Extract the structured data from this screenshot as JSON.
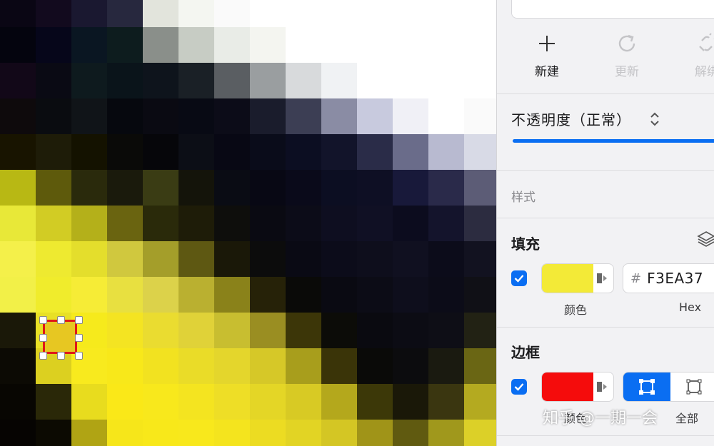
{
  "canvas": {
    "pixel_colors": [
      [
        "#0a0614",
        "#120a1e",
        "#1a1830",
        "#27283e",
        "#e2e4dc",
        "#f4f6f1",
        "#fafafa",
        "#ffffff",
        "#ffffff",
        "#ffffff",
        "#ffffff",
        "#ffffff",
        "#ffffff",
        "#ffffff"
      ],
      [
        "#04040e",
        "#06061a",
        "#0a1622",
        "#0d1c1e",
        "#8a8f8a",
        "#c7ccc4",
        "#e9ece7",
        "#f4f5f0",
        "#ffffff",
        "#ffffff",
        "#ffffff",
        "#ffffff",
        "#ffffff",
        "#ffffff"
      ],
      [
        "#120818",
        "#0a0a14",
        "#0e1a1e",
        "#0a141a",
        "#0e141c",
        "#1a2026",
        "#5a5e62",
        "#9a9ea0",
        "#d8dadc",
        "#f0f2f4",
        "#ffffff",
        "#ffffff",
        "#ffffff",
        "#ffffff"
      ],
      [
        "#0e0a0c",
        "#0a0c10",
        "#101418",
        "#06080e",
        "#0a0a12",
        "#080a14",
        "#0c0c18",
        "#1a1c2c",
        "#3c3e54",
        "#8a8ca4",
        "#c8cade",
        "#f0f0f6",
        "#ffffff",
        "#fafafa"
      ],
      [
        "#181400",
        "#1e1c08",
        "#141200",
        "#0a0a08",
        "#06060a",
        "#0c0e16",
        "#080814",
        "#0a0c1a",
        "#0c0e22",
        "#12142a",
        "#2a2c48",
        "#6a6c8a",
        "#b8bad0",
        "#d8dae6"
      ],
      [
        "#b8b814",
        "#5e5a0c",
        "#2a2a0c",
        "#1a1a0c",
        "#3a3c14",
        "#14140a",
        "#0a0c14",
        "#080814",
        "#0a0a1a",
        "#0c0e22",
        "#0e0f24",
        "#18193a",
        "#2a2a4a",
        "#5c5c76"
      ],
      [
        "#e8e838",
        "#d2cc24",
        "#b4b01a",
        "#6a6410",
        "#2a2a0a",
        "#1e1c08",
        "#0e0e0c",
        "#0a0a12",
        "#0c0c18",
        "#0e0e20",
        "#101024",
        "#0c0c1e",
        "#14142c",
        "#2c2c40"
      ],
      [
        "#f4f04a",
        "#eeea30",
        "#e4de2c",
        "#d0c83e",
        "#a49e2a",
        "#5e5812",
        "#1a1808",
        "#0c0c0c",
        "#0a0a14",
        "#0c0c1a",
        "#0e0e1c",
        "#101020",
        "#0c0c1a",
        "#121220"
      ],
      [
        "#f2f048",
        "#f0ec2c",
        "#f6ec36",
        "#e8e040",
        "#dcd24a",
        "#bab030",
        "#8a821a",
        "#262208",
        "#0a0a08",
        "#0a0a12",
        "#0c0c16",
        "#0e0e1c",
        "#0c0c18",
        "#101016"
      ],
      [
        "#1a1808",
        "#e8e026",
        "#f6ea1c",
        "#f4e422",
        "#eadc30",
        "#e0d238",
        "#c8be30",
        "#9a8e22",
        "#3c3608",
        "#0c0c08",
        "#0a0a10",
        "#0c0c14",
        "#0e0e16",
        "#222214"
      ],
      [
        "#0c0a04",
        "#dcd020",
        "#f8ea1e",
        "#f8e81a",
        "#f2e220",
        "#eadc28",
        "#e4d62c",
        "#d6c828",
        "#a89e1c",
        "#3a3408",
        "#0a0a08",
        "#0c0c0e",
        "#1a1a10",
        "#6a6614"
      ],
      [
        "#080602",
        "#2a2808",
        "#e8dc1e",
        "#fae818",
        "#f8e81c",
        "#f4e420",
        "#eede26",
        "#e4d626",
        "#d8ca24",
        "#b4a81c",
        "#3c3808",
        "#1a1808",
        "#3a3610",
        "#b4aa20"
      ],
      [
        "#060402",
        "#0c0a02",
        "#b0a414",
        "#f6e61a",
        "#f8e81a",
        "#f8e81c",
        "#f4e41e",
        "#ecdc22",
        "#e2d424",
        "#d4c624",
        "#a09418",
        "#605a10",
        "#a0981c",
        "#dcd028"
      ]
    ]
  },
  "panel": {
    "toolbar": [
      {
        "label": "新建",
        "icon": "plus-icon",
        "state": "enabled"
      },
      {
        "label": "更新",
        "icon": "refresh-icon",
        "state": "disabled"
      },
      {
        "label": "解绑",
        "icon": "unlink-icon",
        "state": "disabled"
      }
    ],
    "opacity_label": "不透明度（正常）",
    "opacity_value": 1.0,
    "style_section": "样式",
    "fill": {
      "title": "填充",
      "enabled": true,
      "color": "#F3EA37",
      "color_label": "颜色",
      "hex_value": "F3EA37",
      "hex_label": "Hex"
    },
    "border": {
      "title": "边框",
      "enabled": true,
      "color": "#F50C0C",
      "color_label": "颜色",
      "position_label": "全部"
    }
  },
  "watermark": "知乎 @一期一会",
  "colors": {
    "accent": "#0a6ef2",
    "selection_border": "#e01818"
  }
}
